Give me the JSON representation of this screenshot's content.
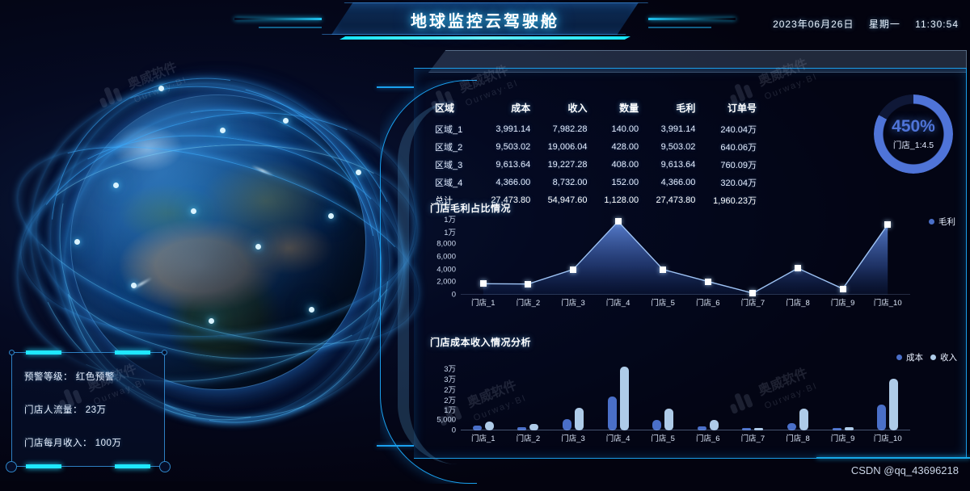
{
  "header": {
    "title": "地球监控云驾驶舱",
    "date": "2023年06月26日",
    "weekday": "星期一",
    "time": "11:30:54"
  },
  "watermark": {
    "brand_cn": "奥威软件",
    "brand_en": "Ourway·BI",
    "csdn": "CSDN @qq_43696218"
  },
  "alert_panel": {
    "rows": [
      "预警等级： 红色预警",
      "门店人流量： 23万",
      "门店每月收入： 100万"
    ]
  },
  "table": {
    "headers": [
      "区域",
      "成本",
      "收入",
      "数量",
      "毛利",
      "订单号"
    ],
    "rows": [
      [
        "区域_1",
        "3,991.14",
        "7,982.28",
        "140.00",
        "3,991.14",
        "240.04万"
      ],
      [
        "区域_2",
        "9,503.02",
        "19,006.04",
        "428.00",
        "9,503.02",
        "640.06万"
      ],
      [
        "区域_3",
        "9,613.64",
        "19,227.28",
        "408.00",
        "9,613.64",
        "760.09万"
      ],
      [
        "区域_4",
        "4,366.00",
        "8,732.00",
        "152.00",
        "4,366.00",
        "320.04万"
      ],
      [
        "总计",
        "27,473.80",
        "54,947.60",
        "1,128.00",
        "27,473.80",
        "1,960.23万"
      ]
    ]
  },
  "gauge": {
    "value": "450%",
    "label": "门店_1:4.5",
    "percent": 83,
    "color": "#4f74d8"
  },
  "chart_data": [
    {
      "type": "area",
      "title": "门店毛利占比情况",
      "xlabel": "",
      "ylabel": "",
      "legend": [
        {
          "name": "毛利",
          "color": "#4a6fc8"
        }
      ],
      "legend_position": "top-right",
      "grid": false,
      "categories": [
        "门店_1",
        "门店_2",
        "门店_3",
        "门店_4",
        "门店_5",
        "门店_6",
        "门店_7",
        "门店_8",
        "门店_9",
        "门店_10"
      ],
      "ytick_labels": [
        "0",
        "2,000",
        "4,000",
        "6,000",
        "8,000",
        "1万",
        "1万"
      ],
      "ytick_values": [
        0,
        2000,
        4000,
        6000,
        8000,
        10000,
        12000
      ],
      "ylim": [
        0,
        12000
      ],
      "series": [
        {
          "name": "毛利",
          "values": [
            1750,
            1700,
            4000,
            11600,
            4000,
            2100,
            250,
            4200,
            950,
            11100
          ]
        }
      ]
    },
    {
      "type": "bar",
      "title": "门店成本收入情况分析",
      "xlabel": "",
      "ylabel": "",
      "legend": [
        {
          "name": "成本",
          "color": "#4a6fc8"
        },
        {
          "name": "收入",
          "color": "#aecbe8"
        }
      ],
      "legend_position": "top-right",
      "grid": false,
      "categories": [
        "门店_1",
        "门店_2",
        "门店_3",
        "门店_4",
        "门店_5",
        "门店_6",
        "门店_7",
        "门店_8",
        "门店_9",
        "门店_10"
      ],
      "ytick_labels": [
        "0",
        "5,000",
        "1万",
        "2万",
        "2万",
        "3万",
        "3万"
      ],
      "ytick_values": [
        0,
        5000,
        10000,
        15000,
        20000,
        25000,
        30000
      ],
      "ylim": [
        0,
        32000
      ],
      "series": [
        {
          "name": "成本",
          "values": [
            2200,
            1500,
            5500,
            16500,
            5200,
            1900,
            300,
            3600,
            900,
            12500
          ]
        },
        {
          "name": "收入",
          "values": [
            4200,
            3300,
            10800,
            31000,
            10500,
            5000,
            600,
            10500,
            1600,
            25000
          ]
        }
      ]
    }
  ]
}
